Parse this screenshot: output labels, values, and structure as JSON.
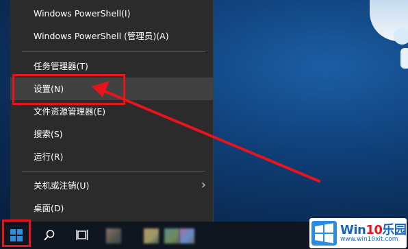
{
  "menu": {
    "items": [
      {
        "label": "Windows PowerShell(I)"
      },
      {
        "label": "Windows PowerShell (管理员)(A)"
      },
      {
        "label": "任务管理器(T)"
      },
      {
        "label": "设置(N)"
      },
      {
        "label": "文件资源管理器(E)"
      },
      {
        "label": "搜索(S)"
      },
      {
        "label": "运行(R)"
      },
      {
        "label": "关机或注销(U)"
      },
      {
        "label": "桌面(D)"
      }
    ],
    "submenu_glyph": "›"
  },
  "taskbar": {
    "icons": [
      "windows-start-icon",
      "search-icon",
      "task-view-icon"
    ]
  },
  "watermark": {
    "brand_win": "Win",
    "brand_10": "10",
    "brand_tail": "乐园",
    "url": "www.win10xit.com"
  },
  "colors": {
    "menu_bg": "#2b2b2b",
    "highlight": "#e8141b",
    "taskbar": "#10161f",
    "brand": "#1565c0"
  }
}
